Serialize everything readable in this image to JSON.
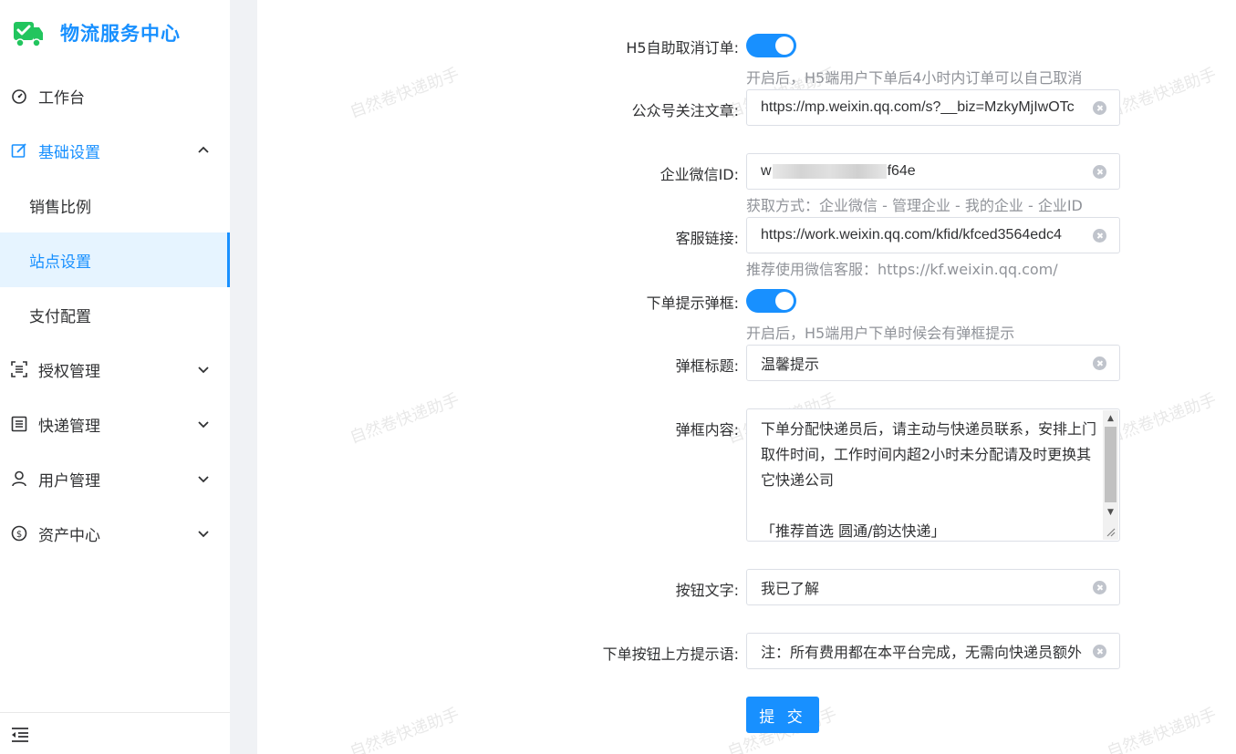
{
  "app": {
    "title": "物流服务中心",
    "brand_color": "#1890ff"
  },
  "sidebar": {
    "items": [
      {
        "label": "工作台",
        "icon": "dashboard-icon"
      },
      {
        "label": "基础设置",
        "icon": "edit-icon",
        "expanded": true
      },
      {
        "label": "授权管理",
        "icon": "scan-icon"
      },
      {
        "label": "快递管理",
        "icon": "list-icon"
      },
      {
        "label": "用户管理",
        "icon": "user-icon"
      },
      {
        "label": "资产中心",
        "icon": "dollar-icon"
      }
    ],
    "subitems": [
      {
        "label": "销售比例"
      },
      {
        "label": "站点设置",
        "selected": true
      },
      {
        "label": "支付配置"
      }
    ]
  },
  "watermark": "自然卷快递助手",
  "form": {
    "h5_cancel": {
      "label": "H5自助取消订单:",
      "enabled": true,
      "hint": "开启后，H5端用户下单后4小时内订单可以自己取消"
    },
    "mp_article": {
      "label": "公众号关注文章:",
      "value": "https://mp.weixin.qq.com/s?__biz=MzkyMjIwOTc"
    },
    "corp_wechat_id": {
      "label": "企业微信ID:",
      "value_prefix": "w",
      "value_suffix": "f64e",
      "hint": "获取方式：企业微信 - 管理企业 - 我的企业 - 企业ID"
    },
    "service_link": {
      "label": "客服链接:",
      "value": "https://work.weixin.qq.com/kfid/kfced3564edc4",
      "hint": "推荐使用微信客服：https://kf.weixin.qq.com/"
    },
    "order_popup": {
      "label": "下单提示弹框:",
      "enabled": true,
      "hint": "开启后，H5端用户下单时候会有弹框提示"
    },
    "popup_title": {
      "label": "弹框标题:",
      "value": "温馨提示"
    },
    "popup_content": {
      "label": "弹框内容:",
      "value": "下单分配快递员后，请主动与快递员联系，安排上门取件时间，工作时间内超2小时未分配请及时更换其它快递公司\n\n「推荐首选 圆通/韵达快递」"
    },
    "button_text": {
      "label": "按钮文字:",
      "value": "我已了解"
    },
    "order_tip": {
      "label": "下单按钮上方提示语:",
      "value": "注：所有费用都在本平台完成，无需向快递员额外"
    },
    "submit_label": "提 交"
  }
}
